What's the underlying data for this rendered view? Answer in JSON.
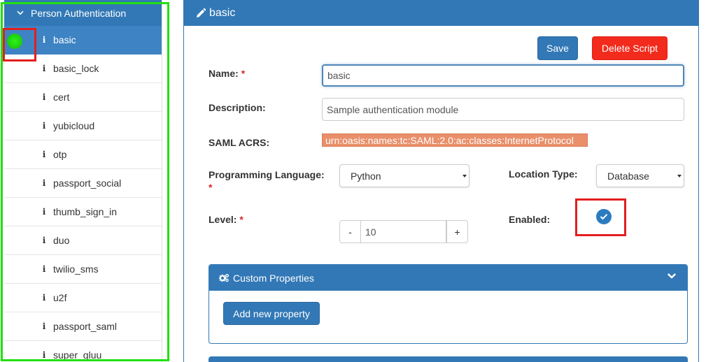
{
  "sidebar": {
    "group_label": "Person Authentication",
    "items": [
      {
        "label": "basic"
      },
      {
        "label": "basic_lock"
      },
      {
        "label": "cert"
      },
      {
        "label": "yubicloud"
      },
      {
        "label": "otp"
      },
      {
        "label": "passport_social"
      },
      {
        "label": "thumb_sign_in"
      },
      {
        "label": "duo"
      },
      {
        "label": "twilio_sms"
      },
      {
        "label": "u2f"
      },
      {
        "label": "passport_saml"
      },
      {
        "label": "super_gluu"
      }
    ],
    "info_glyph": "i",
    "status_color": "#22e012"
  },
  "panel": {
    "title": "basic",
    "save_label": "Save",
    "delete_label": "Delete Script",
    "fields": {
      "name_label": "Name:",
      "name_value": "basic",
      "description_label": "Description:",
      "description_value": "Sample authentication module",
      "acrs_label": "SAML ACRS:",
      "acrs_value": "urn:oasis:names:tc:SAML:2.0:ac:classes:InternetProtocol",
      "language_label": "Programming Language:",
      "language_value": "Python",
      "location_label": "Location Type:",
      "location_value": "Database",
      "level_label": "Level:",
      "level_value": "10",
      "level_minus": "-",
      "level_plus": "+",
      "enabled_label": "Enabled:",
      "required_mark": "*"
    },
    "custom_properties": {
      "title": "Custom Properties",
      "add_label": "Add new property"
    }
  },
  "colors": {
    "primary": "#3278b6",
    "danger": "#f22b1d",
    "acrs_chip": "#e98f6a",
    "highlight_green": "#22e012",
    "highlight_red": "#e51e1e"
  }
}
